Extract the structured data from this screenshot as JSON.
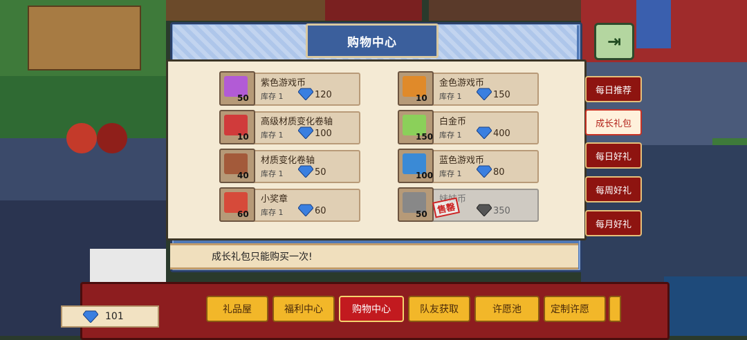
{
  "shop": {
    "title": "购物中心",
    "notice": "成长礼包只能购买一次!",
    "items": [
      {
        "name": "紫色游戏币",
        "stock": "库存 1",
        "price": "120",
        "qty": "50",
        "color": "#b25bd6"
      },
      {
        "name": "高级材质变化卷轴",
        "stock": "库存 1",
        "price": "100",
        "qty": "10",
        "color": "#d03b3b"
      },
      {
        "name": "材质变化卷轴",
        "stock": "库存 1",
        "price": "50",
        "qty": "40",
        "color": "#a35a3a"
      },
      {
        "name": "小奖章",
        "stock": "库存 1",
        "price": "60",
        "qty": "60",
        "color": "#d64a3a"
      },
      {
        "name": "金色游戏币",
        "stock": "库存 1",
        "price": "150",
        "qty": "10",
        "color": "#e08a2a"
      },
      {
        "name": "白金币",
        "stock": "库存 1",
        "price": "400",
        "qty": "150",
        "color": "#8bd05a"
      },
      {
        "name": "蓝色游戏币",
        "stock": "库存 1",
        "price": "80",
        "qty": "100",
        "color": "#3a8ad6"
      },
      {
        "name": "妹妹币",
        "stock": "",
        "price": "350",
        "qty": "50",
        "color": "#888",
        "sold_label": "售罄"
      }
    ]
  },
  "tabs": [
    "每日推荐",
    "成长礼包",
    "每日好礼",
    "每周好礼",
    "每月好礼"
  ],
  "bottom": {
    "gems": "101",
    "buttons": [
      "礼品屋",
      "福利中心",
      "购物中心",
      "队友获取",
      "许愿池",
      "定制许愿"
    ]
  },
  "colors": {
    "gem": "#3a7fe0",
    "active_red": "#c21a1f",
    "gold": "#f2b729"
  }
}
